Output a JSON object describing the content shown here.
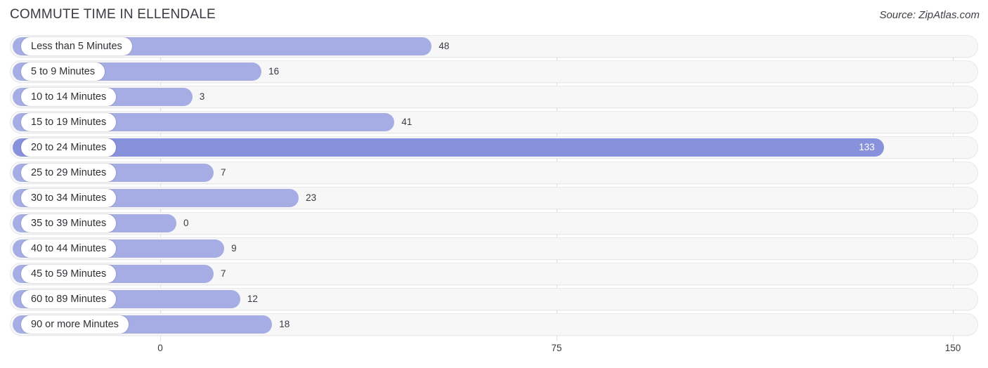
{
  "header": {
    "title": "COMMUTE TIME IN ELLENDALE",
    "source": "Source: ZipAtlas.com"
  },
  "colors": {
    "bar": "#a6adE4",
    "bar_highlight": "#8791dc",
    "track": "#f7f7f8",
    "gridline": "#e0e0e2",
    "text": "#3a3a42"
  },
  "chart_data": {
    "type": "bar",
    "orientation": "horizontal",
    "title": "COMMUTE TIME IN ELLENDALE",
    "xlabel": "",
    "ylabel": "",
    "xlim": [
      0,
      150
    ],
    "ticks": [
      "0",
      "75",
      "150"
    ],
    "tick_values": [
      0,
      75,
      150
    ],
    "grid": true,
    "legend": false,
    "highlight_index": 4,
    "categories": [
      "Less than 5 Minutes",
      "5 to 9 Minutes",
      "10 to 14 Minutes",
      "15 to 19 Minutes",
      "20 to 24 Minutes",
      "25 to 29 Minutes",
      "30 to 34 Minutes",
      "35 to 39 Minutes",
      "40 to 44 Minutes",
      "45 to 59 Minutes",
      "60 to 89 Minutes",
      "90 or more Minutes"
    ],
    "values": [
      48,
      16,
      3,
      41,
      133,
      7,
      23,
      0,
      9,
      7,
      12,
      18
    ],
    "value_labels": [
      "48",
      "16",
      "3",
      "41",
      "133",
      "7",
      "23",
      "0",
      "9",
      "7",
      "12",
      "18"
    ]
  }
}
